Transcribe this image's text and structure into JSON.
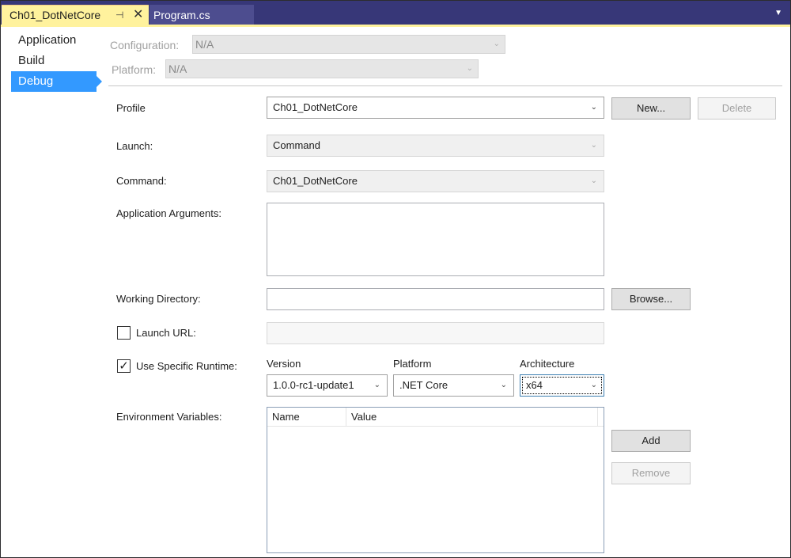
{
  "tabs": {
    "active_label": "Ch01_DotNetCore",
    "pin_glyph": "⊣",
    "close_glyph": "✕",
    "inactive_label": "Program.cs",
    "overflow_glyph": "▼"
  },
  "nav": {
    "items": [
      {
        "label": "Application"
      },
      {
        "label": "Build"
      },
      {
        "label": "Debug"
      }
    ],
    "active_index": 2
  },
  "config": {
    "configuration_label": "Configuration:",
    "configuration_value": "N/A",
    "platform_label": "Platform:",
    "platform_value": "N/A"
  },
  "form": {
    "profile_label": "Profile",
    "profile_value": "Ch01_DotNetCore",
    "new_button": "New...",
    "delete_button": "Delete",
    "launch_label": "Launch:",
    "launch_value": "Command",
    "command_label": "Command:",
    "command_value": "Ch01_DotNetCore",
    "app_args_label": "Application Arguments:",
    "app_args_value": "",
    "working_dir_label": "Working Directory:",
    "working_dir_value": "",
    "browse_button": "Browse...",
    "launch_url_label": "Launch URL:",
    "launch_url_checked": false,
    "launch_url_value": "",
    "use_runtime_label": "Use Specific Runtime:",
    "use_runtime_checked": true,
    "check_glyph": "✓",
    "version_header": "Version",
    "version_value": "1.0.0-rc1-update1",
    "platform_header": "Platform",
    "platform_value": ".NET Core",
    "architecture_header": "Architecture",
    "architecture_value": "x64",
    "env_vars_label": "Environment Variables:",
    "env_columns": [
      "Name",
      "Value"
    ],
    "add_button": "Add",
    "remove_button": "Remove"
  },
  "colors": {
    "accent_tab": "#fff29d",
    "nav_selected": "#3399ff",
    "tabbar": "#373778"
  }
}
